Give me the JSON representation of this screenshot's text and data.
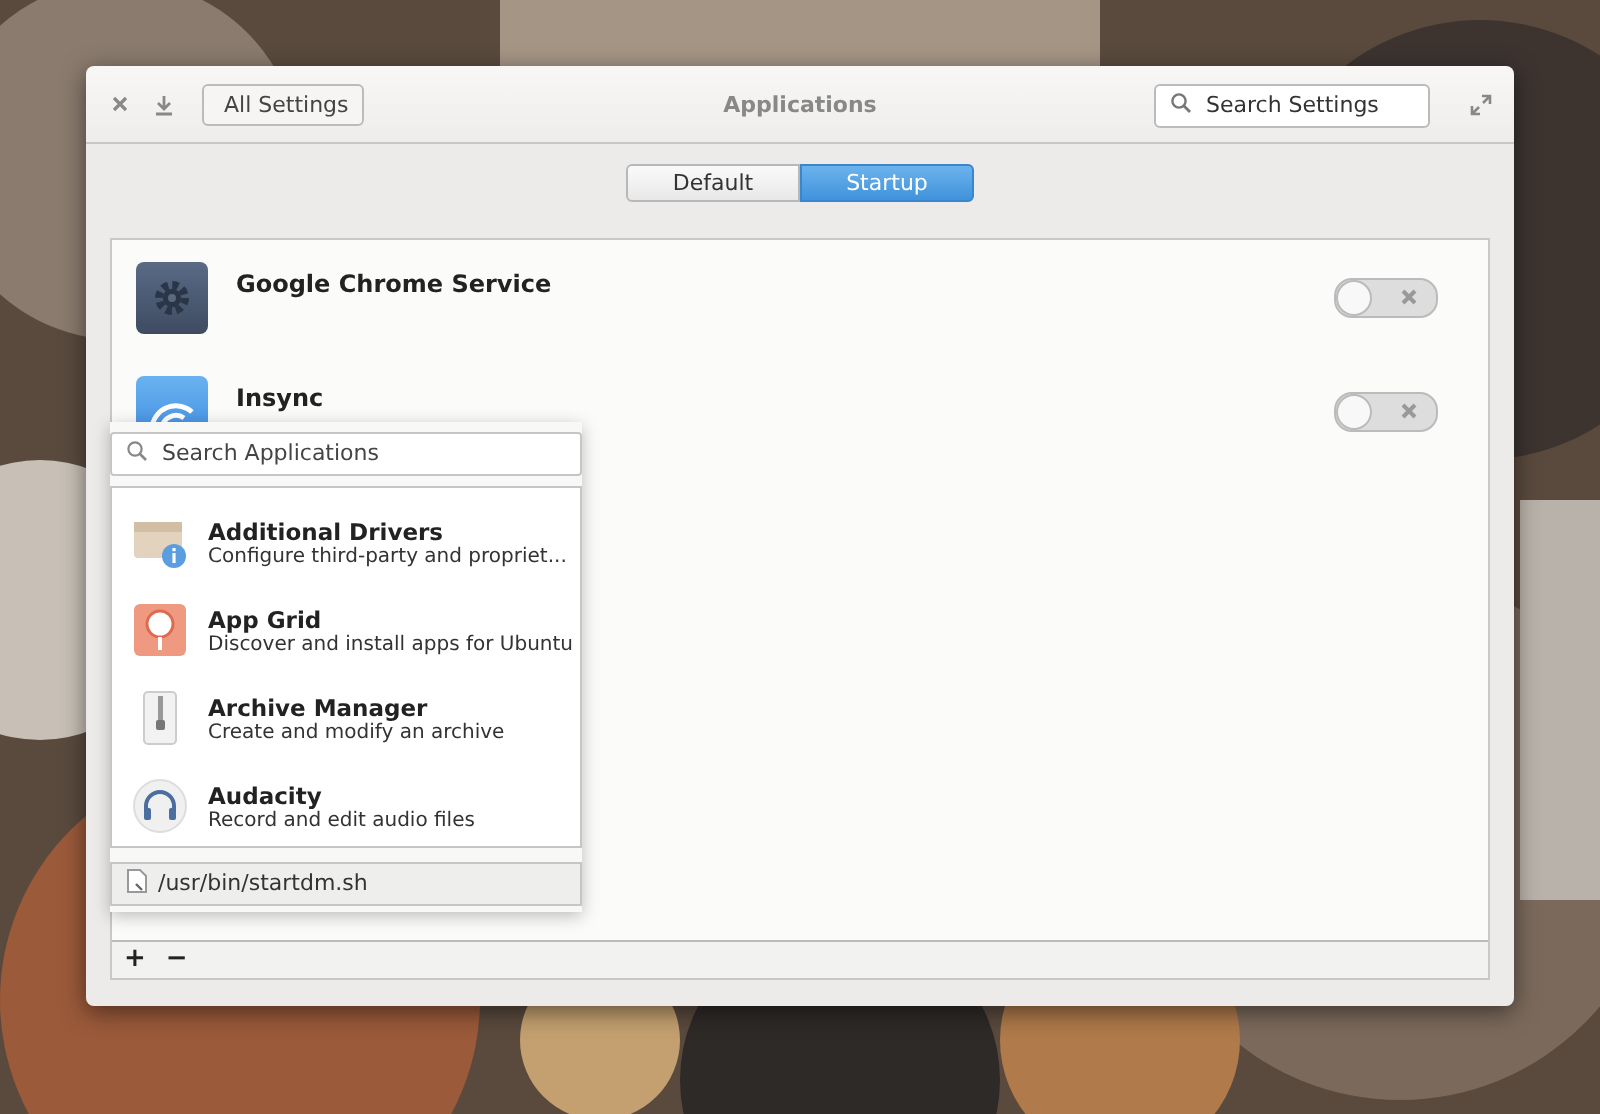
{
  "window": {
    "title": "Applications",
    "back_button": "All Settings",
    "search": {
      "placeholder": "Search Settings"
    }
  },
  "tabs": [
    {
      "label": "Default",
      "selected": false
    },
    {
      "label": "Startup",
      "selected": true
    }
  ],
  "startup_items": [
    {
      "name": "Google Chrome Service",
      "kind": "gear",
      "on": false
    },
    {
      "name": "Insync",
      "kind": "sync",
      "on": false
    }
  ],
  "popover": {
    "search": {
      "placeholder": "Search Applications"
    },
    "apps": [
      {
        "name": "Additional Drivers",
        "description": "Configure third-party and propriet...",
        "kind": "package"
      },
      {
        "name": "App Grid",
        "description": "Discover and install apps for Ubuntu",
        "kind": "grid"
      },
      {
        "name": "Archive Manager",
        "description": "Create and modify an archive",
        "kind": "archive"
      },
      {
        "name": "Audacity",
        "description": "Record and edit audio files",
        "kind": "headphones"
      }
    ],
    "command": {
      "value": "/usr/bin/startdm.sh"
    }
  },
  "toolbar": [
    "+",
    "−"
  ]
}
